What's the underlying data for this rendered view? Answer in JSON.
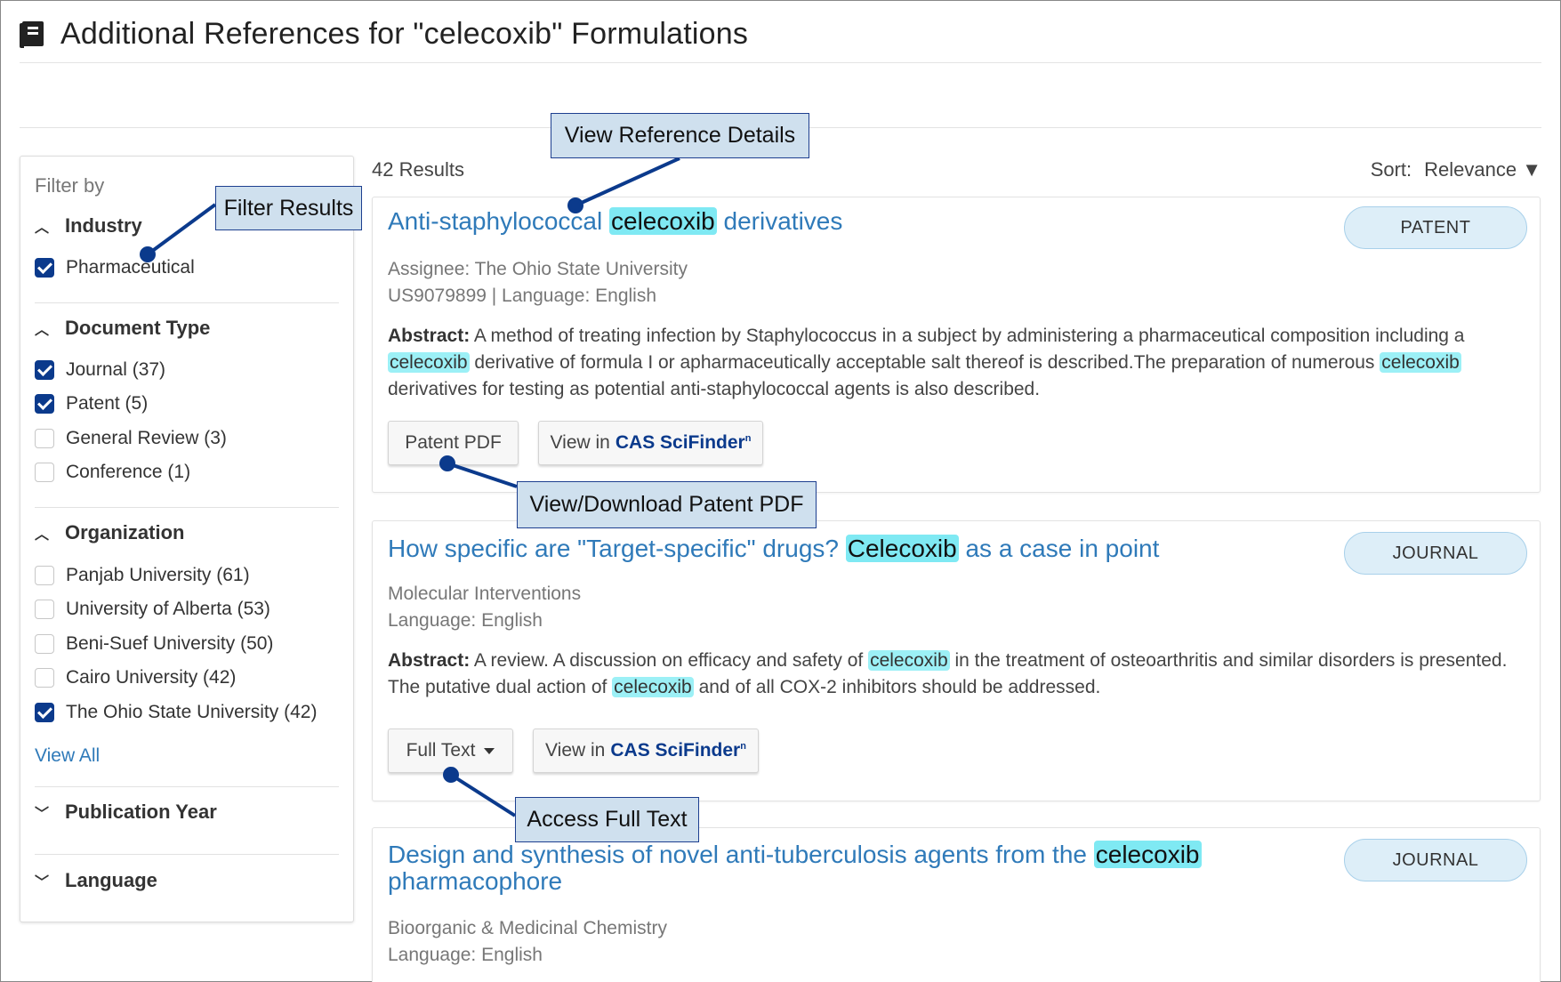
{
  "header": {
    "title": "Additional References for \"celecoxib\" Formulations",
    "icon": "book-icon"
  },
  "sidebar": {
    "filter_by": "Filter by",
    "groups": [
      {
        "label": "Industry",
        "expanded": true,
        "options": [
          {
            "label": "Pharmaceutical",
            "checked": true
          }
        ]
      },
      {
        "label": "Document Type",
        "expanded": true,
        "options": [
          {
            "label": "Journal (37)",
            "checked": true
          },
          {
            "label": "Patent (5)",
            "checked": true
          },
          {
            "label": "General Review (3)",
            "checked": false
          },
          {
            "label": "Conference (1)",
            "checked": false
          }
        ]
      },
      {
        "label": "Organization",
        "expanded": true,
        "options": [
          {
            "label": "Panjab University (61)",
            "checked": false
          },
          {
            "label": "University of Alberta (53)",
            "checked": false
          },
          {
            "label": "Beni-Suef University (50)",
            "checked": false
          },
          {
            "label": "Cairo University (42)",
            "checked": false
          },
          {
            "label": "The Ohio State University (42)",
            "checked": true
          }
        ]
      },
      {
        "label": "Publication Year",
        "expanded": false
      },
      {
        "label": "Language",
        "expanded": false
      }
    ],
    "view_all": "View All"
  },
  "results": {
    "count": "42 Results",
    "sort_label": "Sort:",
    "sort_value": "Relevance ▼",
    "items": [
      {
        "title_pre": "Anti-staphylococcal ",
        "title_hl": "celecoxib",
        "title_post": " derivatives",
        "badge": "PATENT",
        "meta1": "Assignee: The Ohio State University",
        "meta2": "US9079899 | Language: English",
        "abstract_label": "Abstract:",
        "abstract_1": " A method of treating infection by Staphylococcus in a subject by administering a pharmaceutical composition including a ",
        "abstract_hl1": "celecoxib",
        "abstract_2": " derivative of formula I or apharmaceutically acceptable salt thereof is described.The preparation of numerous ",
        "abstract_hl2": "celecoxib",
        "abstract_3": " derivatives for testing as potential anti-staphylococcal agents is also described.",
        "btn1": "Patent PDF",
        "btn2_pre": "View in",
        "btn2_brand": "CAS SciFinder",
        "btn2_sup": "n"
      },
      {
        "title_pre": "How specific are \"Target-specific\" drugs? ",
        "title_hl": "Celecoxib",
        "title_post": " as a case in point",
        "badge": "JOURNAL",
        "meta1": "Molecular Interventions",
        "meta2": "Language: English",
        "abstract_label": "Abstract:",
        "abstract_1": " A review. A discussion on efficacy and safety of ",
        "abstract_hl1": "celecoxib",
        "abstract_2": " in the treatment of osteoarthritis and similar disorders is presented. The putative dual action of ",
        "abstract_hl2": "celecoxib",
        "abstract_3": " and of all COX-2 inhibitors should be addressed.",
        "btn1": "Full Text",
        "btn2_pre": "View in",
        "btn2_brand": "CAS SciFinder",
        "btn2_sup": "n"
      },
      {
        "title_pre": "Design and synthesis of novel anti-tuberculosis agents from the ",
        "title_hl": "celecoxib",
        "title_post": " pharmacophore",
        "badge": "JOURNAL",
        "meta1": "Bioorganic & Medicinal Chemistry",
        "meta2": "Language: English"
      }
    ]
  },
  "callouts": {
    "filter": "Filter Results",
    "details": "View Reference Details",
    "pdf": "View/Download Patent PDF",
    "fulltext": "Access Full Text"
  },
  "colors": {
    "link": "#2f7ab9",
    "highlight": "#7fe9f3",
    "check": "#0b3a8c",
    "callout_bg": "#cfe0ee",
    "callout_line": "#0b3a8c"
  }
}
